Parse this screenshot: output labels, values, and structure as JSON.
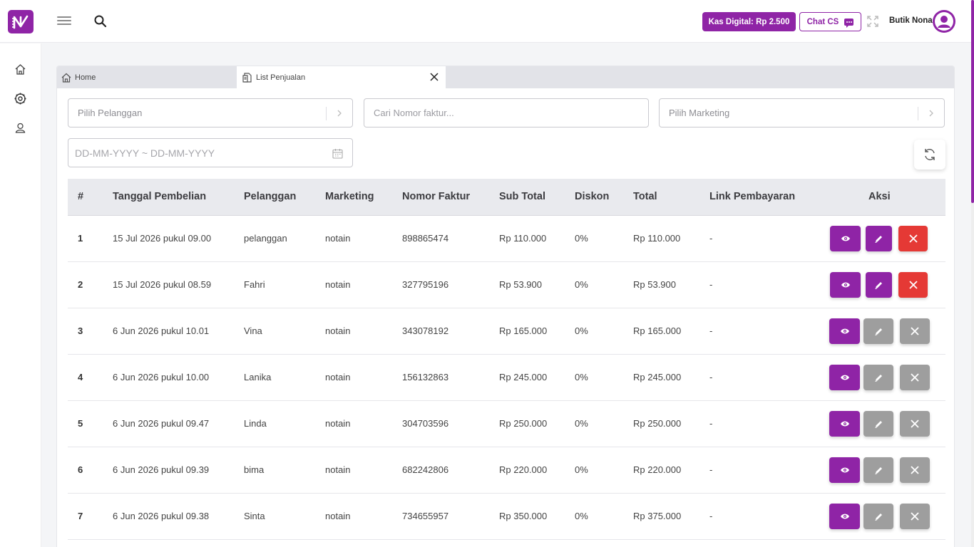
{
  "header": {
    "kas_label": "Kas Digital: Rp 2.500",
    "chat_label": "Chat CS",
    "user_name": "Butik Nona"
  },
  "tabs": [
    {
      "label": "Home",
      "icon": "home-icon"
    },
    {
      "label": "List Penjualan",
      "icon": "document-icon",
      "active": true
    }
  ],
  "filters": {
    "customer_placeholder": "Pilih Pelanggan",
    "invoice_placeholder": "Cari Nomor faktur...",
    "marketing_placeholder": "Pilih Marketing",
    "date_placeholder": "DD-MM-YYYY ~ DD-MM-YYYY"
  },
  "table": {
    "headers": [
      "#",
      "Tanggal Pembelian",
      "Pelanggan",
      "Marketing",
      "Nomor Faktur",
      "Sub Total",
      "Diskon",
      "Total",
      "Link Pembayaran",
      "Aksi"
    ],
    "rows": [
      {
        "no": "1",
        "date": "15 Jul 2026 pukul 09.00",
        "customer": "pelanggan",
        "marketing": "notain",
        "invoice": "898865474",
        "subtotal": "Rp 110.000",
        "discount": "0%",
        "total": "Rp 110.000",
        "link": "-",
        "editable": true
      },
      {
        "no": "2",
        "date": "15 Jul 2026 pukul 08.59",
        "customer": "Fahri",
        "marketing": "notain",
        "invoice": "327795196",
        "subtotal": "Rp 53.900",
        "discount": "0%",
        "total": "Rp 53.900",
        "link": "-",
        "editable": true
      },
      {
        "no": "3",
        "date": "6 Jun 2026 pukul 10.01",
        "customer": "Vina",
        "marketing": "notain",
        "invoice": "343078192",
        "subtotal": "Rp 165.000",
        "discount": "0%",
        "total": "Rp 165.000",
        "link": "-",
        "editable": false
      },
      {
        "no": "4",
        "date": "6 Jun 2026 pukul 10.00",
        "customer": "Lanika",
        "marketing": "notain",
        "invoice": "156132863",
        "subtotal": "Rp 245.000",
        "discount": "0%",
        "total": "Rp 245.000",
        "link": "-",
        "editable": false
      },
      {
        "no": "5",
        "date": "6 Jun 2026 pukul 09.47",
        "customer": "Linda",
        "marketing": "notain",
        "invoice": "304703596",
        "subtotal": "Rp 250.000",
        "discount": "0%",
        "total": "Rp 250.000",
        "link": "-",
        "editable": false
      },
      {
        "no": "6",
        "date": "6 Jun 2026 pukul 09.39",
        "customer": "bima",
        "marketing": "notain",
        "invoice": "682242806",
        "subtotal": "Rp 220.000",
        "discount": "0%",
        "total": "Rp 220.000",
        "link": "-",
        "editable": false
      },
      {
        "no": "7",
        "date": "6 Jun 2026 pukul 09.38",
        "customer": "Sinta",
        "marketing": "notain",
        "invoice": "734655957",
        "subtotal": "Rp 350.000",
        "discount": "0%",
        "total": "Rp 375.000",
        "link": "-",
        "editable": false
      }
    ]
  },
  "colors": {
    "brand": "#8f24a6",
    "danger": "#e53935",
    "disabled": "#9e9e9e"
  }
}
